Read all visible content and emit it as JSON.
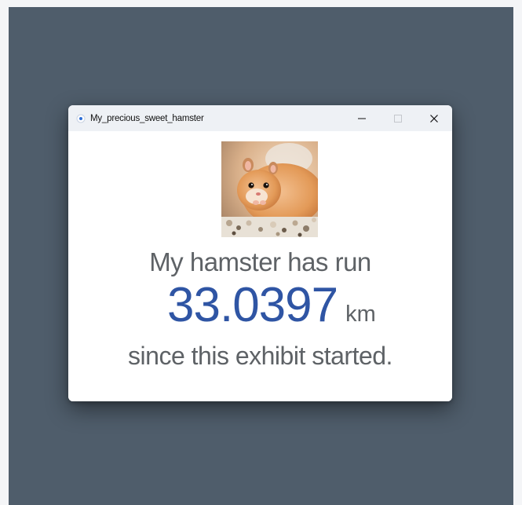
{
  "window": {
    "title": "My_precious_sweet_hamster",
    "controls": {
      "minimize_icon": "minimize-icon",
      "maximize_icon": "maximize-icon",
      "close_icon": "close-icon"
    }
  },
  "main": {
    "photo_icon": "hamster-photo",
    "line1": "My hamster has run",
    "distance_value": "33.0397",
    "distance_unit": "km",
    "line3": "since this exhibit started."
  },
  "colors": {
    "backdrop": "#4f5d6b",
    "titlebar": "#eef1f5",
    "distance_accent": "#2f55a4",
    "body_text": "#5e6266"
  }
}
